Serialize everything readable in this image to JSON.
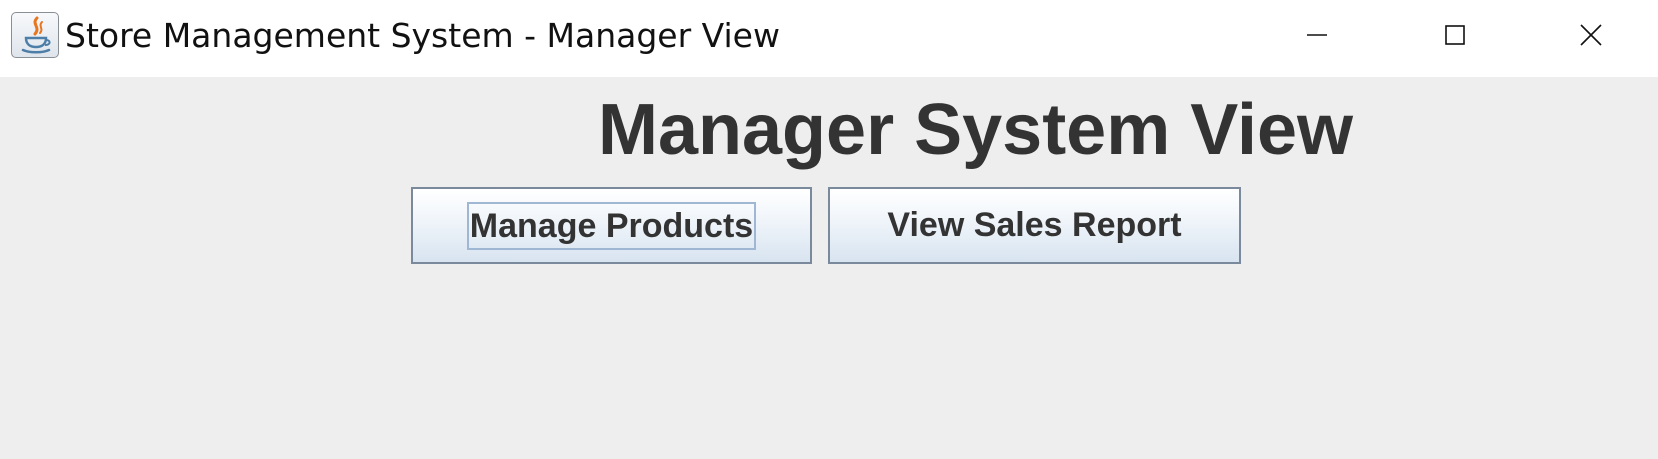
{
  "window": {
    "title": "Store Management System - Manager View",
    "icon": "java-coffee-cup-icon",
    "controls": {
      "minimize": "minimize-icon",
      "maximize": "maximize-icon",
      "close": "close-icon"
    }
  },
  "main": {
    "heading": "Manager System View",
    "buttons": {
      "manage_products": "Manage Products",
      "view_sales_report": "View Sales Report"
    },
    "focused_button": "manage_products"
  },
  "colors": {
    "background": "#eeeeee",
    "titlebar": "#ffffff",
    "text": "#333333",
    "button_border": "#7a8a9c",
    "focus_ring": "#9fb7d3"
  }
}
